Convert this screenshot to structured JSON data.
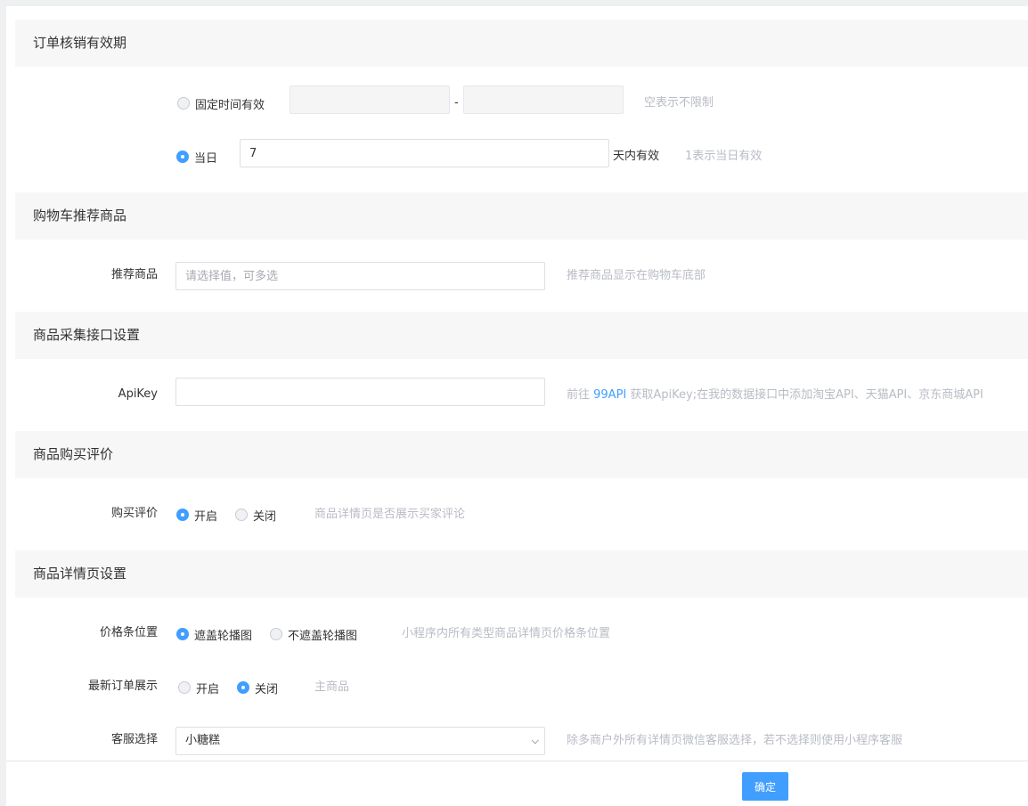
{
  "sections": {
    "verify": {
      "title": "订单核销有效期"
    },
    "recommend": {
      "title": "购物车推荐商品"
    },
    "collect": {
      "title": "商品采集接口设置"
    },
    "review": {
      "title": "商品购买评价"
    },
    "detail": {
      "title": "商品详情页设置"
    }
  },
  "verify": {
    "fixed_label": "固定时间有效",
    "fixed_checked": false,
    "start_value": "",
    "separator": "-",
    "end_value": "",
    "fixed_hint": "空表示不限制",
    "days_label": "当日",
    "days_checked": true,
    "days_value": "7",
    "days_suffix": "天内有效",
    "days_hint": "1表示当日有效"
  },
  "recommend": {
    "label": "推荐商品",
    "placeholder": "请选择值，可多选",
    "hint": "推荐商品显示在购物车底部"
  },
  "collect": {
    "label": "ApiKey",
    "value": "",
    "hint_prefix": "前往 ",
    "hint_link": "99API",
    "hint_suffix": " 获取ApiKey;在我的数据接口中添加淘宝API、天猫API、京东商城API"
  },
  "review": {
    "label": "购买评价",
    "options": [
      {
        "label": "开启",
        "checked": true
      },
      {
        "label": "关闭",
        "checked": false
      }
    ],
    "hint": "商品详情页是否展示买家评论"
  },
  "detail": {
    "price_bar": {
      "label": "价格条位置",
      "options": [
        {
          "label": "遮盖轮播图",
          "checked": true
        },
        {
          "label": "不遮盖轮播图",
          "checked": false
        }
      ],
      "hint": "小程序内所有类型商品详情页价格条位置"
    },
    "latest_order": {
      "label": "最新订单展示",
      "options": [
        {
          "label": "开启",
          "checked": false
        },
        {
          "label": "关闭",
          "checked": true
        }
      ],
      "hint": "主商品"
    },
    "service": {
      "label": "客服选择",
      "selected": "小糖糕",
      "hint": "除多商户外所有详情页微信客服选择，若不选择则使用小程序客服"
    }
  },
  "footer": {
    "confirm_label": "确定"
  },
  "colors": {
    "primary": "#409eff",
    "hint": "#b8bcc4",
    "header_bg": "#f7f7f7"
  }
}
